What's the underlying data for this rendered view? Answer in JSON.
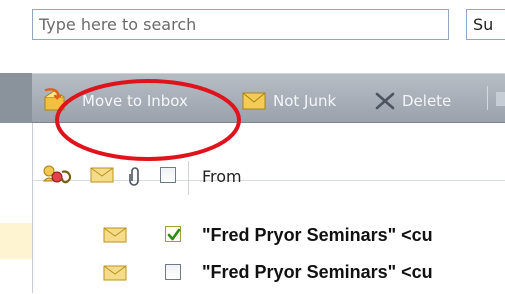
{
  "search": {
    "placeholder": "Type here to search",
    "scope_label": "Su"
  },
  "toolbar": {
    "move_to_inbox_label": "Move to Inbox",
    "not_junk_label": "Not Junk",
    "delete_label": "Delete"
  },
  "list": {
    "columns": {
      "from_label": "From"
    },
    "rows": [
      {
        "from": "\"Fred Pryor Seminars\" <cu",
        "checked": true,
        "read": false
      },
      {
        "from": "\"Fred Pryor Seminars\" <cu",
        "checked": false,
        "read": false
      }
    ]
  },
  "annotation": {
    "color": "#e0121b"
  },
  "colors": {
    "toolbar": "#a6adb6",
    "selected_row_band": "#fff4d2",
    "envelope": "#f2cd5c"
  }
}
